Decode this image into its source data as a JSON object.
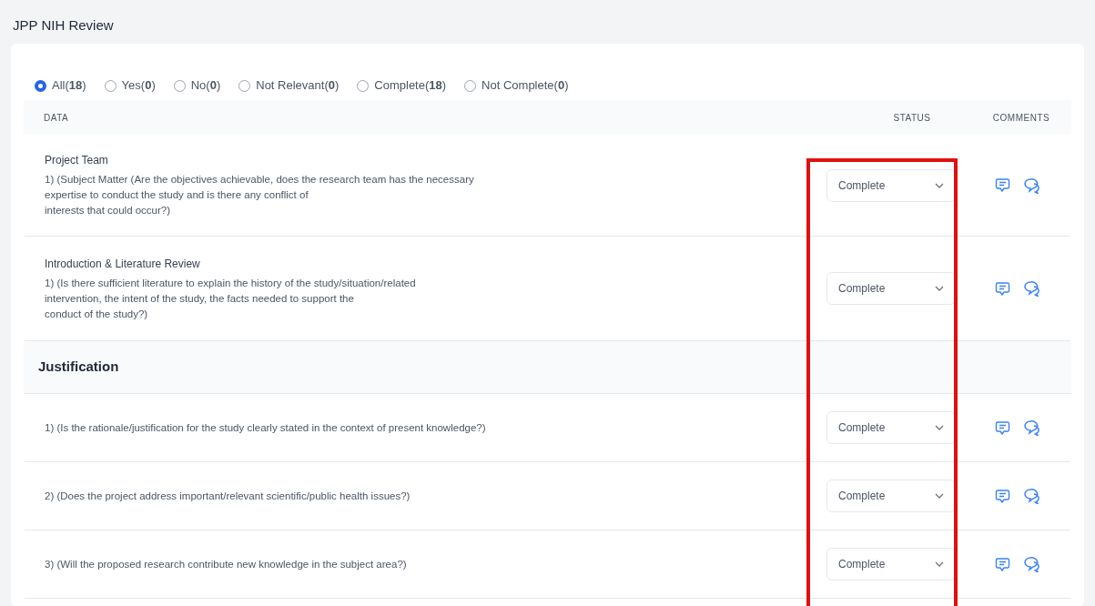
{
  "page_title": "JPP NIH Review",
  "filters": [
    {
      "label": "All(**18**)",
      "selected": true
    },
    {
      "label": "Yes(**0**)",
      "selected": false
    },
    {
      "label": "No(**0**)",
      "selected": false
    },
    {
      "label": "Not Relevant(**0**)",
      "selected": false
    },
    {
      "label": "Complete(**18**)",
      "selected": false
    },
    {
      "label": "Not Complete(**0**)",
      "selected": false
    }
  ],
  "columns": [
    "DATA",
    "STATUS",
    "COMMENTS"
  ],
  "status_column_highlighted": true,
  "rows": [
    {
      "kind": "question",
      "title": "Project Team",
      "text": "1) (Subject Matter (Are the objectives achievable, does the research team has the necessary\nexpertise to conduct the study and is there any conflict of\ninterests that could occur?)",
      "status": "Complete"
    },
    {
      "kind": "question",
      "title": "Introduction & Literature Review",
      "text": "1) (Is there sufficient literature to explain the history of the study/situation/related\nintervention, the intent of the study, the facts needed to support the\nconduct of the study?)",
      "status": "Complete"
    },
    {
      "kind": "section",
      "title": "Justification"
    },
    {
      "kind": "question",
      "text": "1) (Is the rationale/justification for the study clearly stated in the context of present knowledge?)",
      "status": "Complete"
    },
    {
      "kind": "question",
      "text": "2) (Does the project address important/relevant scientific/public health issues?)",
      "status": "Complete"
    },
    {
      "kind": "question",
      "text": "3) (Will the proposed research contribute new knowledge in the subject area?)",
      "status": "Complete"
    }
  ]
}
